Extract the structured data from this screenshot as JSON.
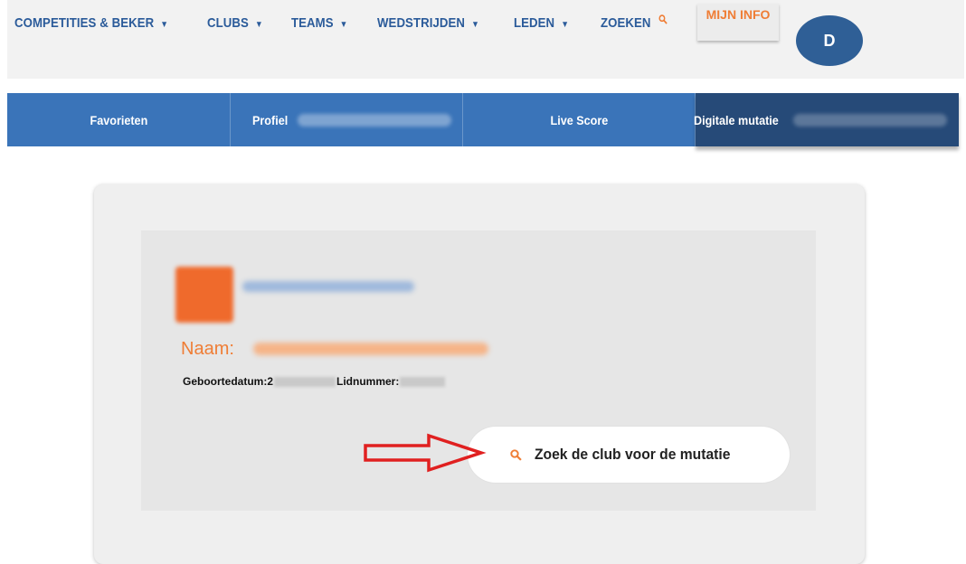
{
  "topnav": {
    "items": [
      {
        "label": "COMPETITIES & BEKER"
      },
      {
        "label": "CLUBS"
      },
      {
        "label": "TEAMS"
      },
      {
        "label": "WEDSTRIJDEN"
      },
      {
        "label": "LEDEN"
      },
      {
        "label": "ZOEKEN"
      }
    ],
    "mijn_info": "MIJN INFO",
    "avatar_initial": "D"
  },
  "tabs": [
    {
      "label": "Favorieten"
    },
    {
      "label": "Profiel"
    },
    {
      "label": "Live Score"
    },
    {
      "label": "Digitale mutatie"
    }
  ],
  "member": {
    "naam_label": "Naam:",
    "geboortedatum_label": "Geboortedatum:2",
    "lidnummer_label": "Lidnummer:"
  },
  "search_button": {
    "label": "Zoek de club voor de mutatie",
    "icon": "search-icon"
  },
  "colors": {
    "brand_blue": "#3a74b9",
    "active_tab": "#264a78",
    "accent_orange": "#ef7d35",
    "annotation_red": "#e02020"
  }
}
